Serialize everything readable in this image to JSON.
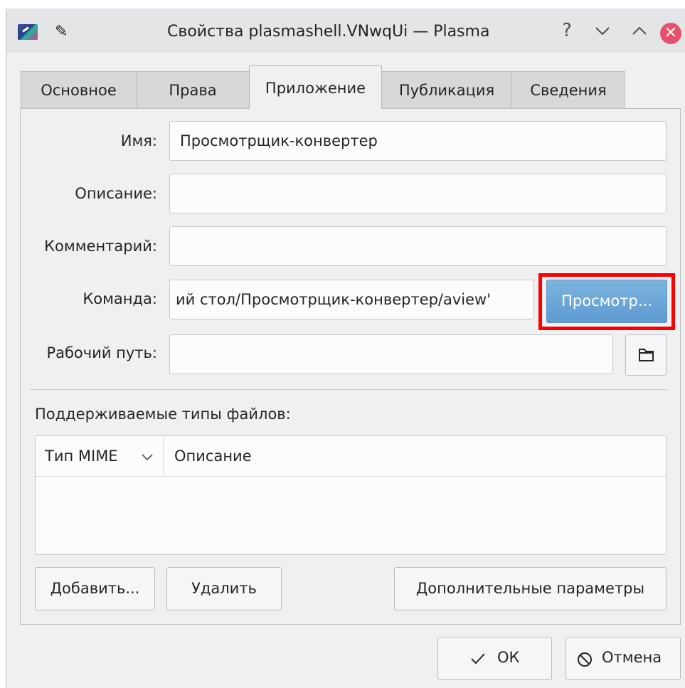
{
  "window": {
    "title": "Свойства plasmashell.VNwqUi — Plasma",
    "help_symbol": "?",
    "minimize_symbol": "⌄",
    "maximize_symbol": "⌃",
    "close_symbol": "✕"
  },
  "tabs": [
    {
      "label": "Основное"
    },
    {
      "label": "Права"
    },
    {
      "label": "Приложение"
    },
    {
      "label": "Публикация"
    },
    {
      "label": "Сведения"
    }
  ],
  "form": {
    "name_label": "Имя:",
    "name_value": "Просмотрщик-конвертер",
    "description_label": "Описание:",
    "description_value": "",
    "comment_label": "Комментарий:",
    "comment_value": "",
    "command_label": "Команда:",
    "command_value": "ий стол/Просмотрщик-конвертер/aview'",
    "browse_button": "Просмотр...",
    "workdir_label": "Рабочий путь:",
    "workdir_value": ""
  },
  "filetypes": {
    "section_label": "Поддерживаемые типы файлов:",
    "col_mime": "Тип MIME",
    "col_description": "Описание",
    "add_button": "Добавить...",
    "remove_button": "Удалить",
    "advanced_button": "Дополнительные параметры"
  },
  "dialog_buttons": {
    "ok": "ОК",
    "cancel": "Отмена"
  },
  "colors": {
    "accent": "#5d9bd2",
    "highlight": "#ff0000",
    "close": "#e8506a"
  }
}
